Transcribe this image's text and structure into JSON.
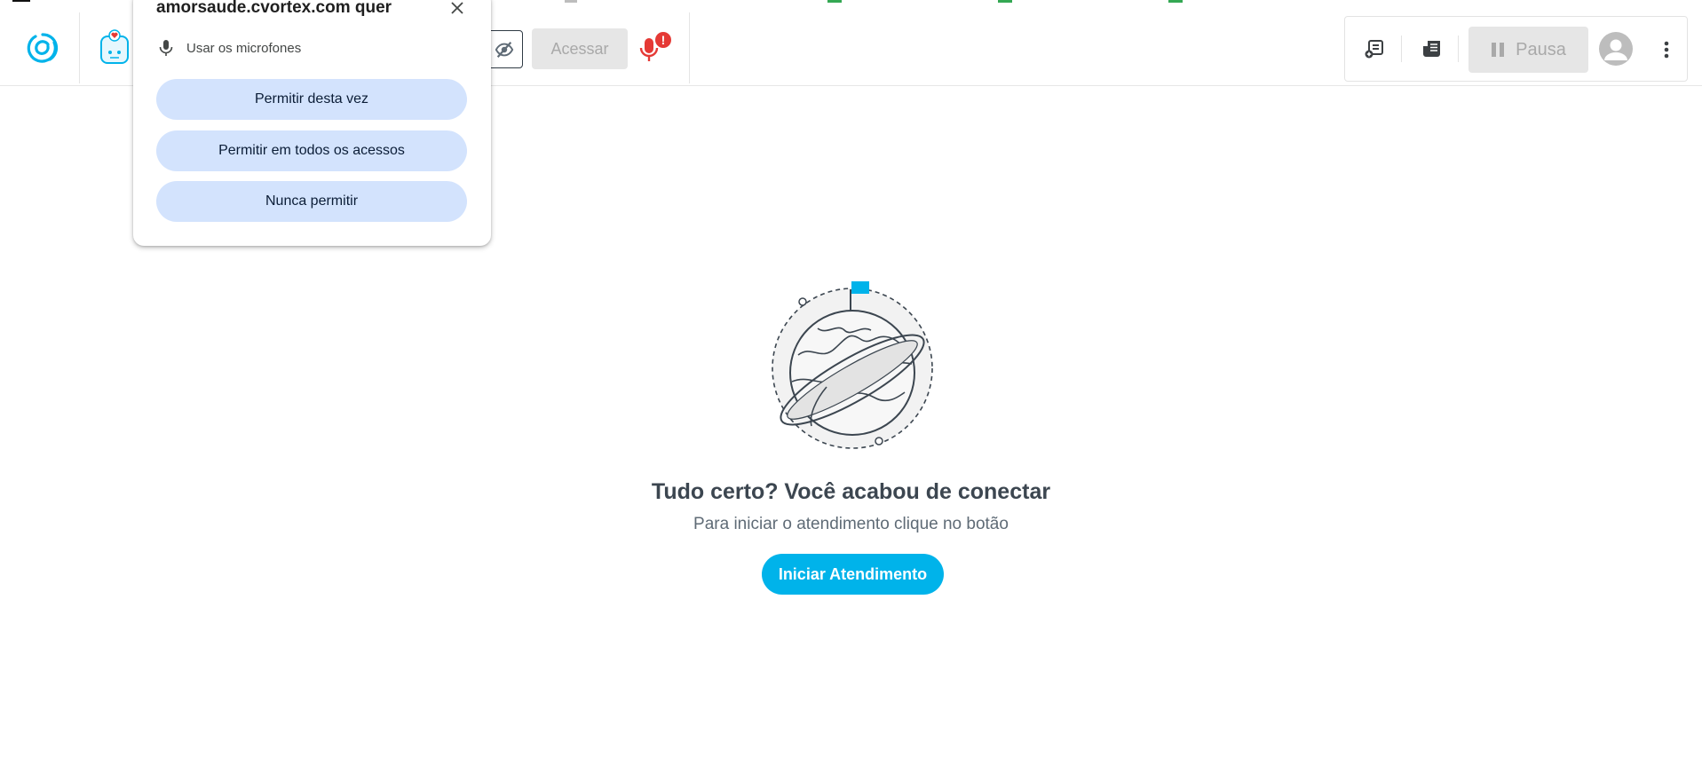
{
  "colors": {
    "brand": "#00b3ea",
    "alert_red": "#e53935",
    "permission_button_bg": "#d3e3fd",
    "disabled_bg": "#e6e6e6",
    "disabled_text": "#a9a9a9"
  },
  "header": {
    "logo_icon": "swirl-logo-icon",
    "robot_icon": "robot-heart-icon",
    "visibility_icon": "eye-off-icon",
    "acessar_label": "Acessar",
    "mic_icon": "microphone-alert-icon",
    "mic_badge": "!"
  },
  "toolbar": {
    "icon1": "document-add-icon",
    "icon2": "newspaper-icon",
    "pausa_label": "Pausa",
    "pause_icon": "pause-icon",
    "avatar_icon": "user-avatar-icon",
    "more_icon": "more-vertical-icon"
  },
  "permission_popup": {
    "title": "amorsaude.cvortex.com quer",
    "request": "Usar os microfones",
    "buttons": [
      "Permitir desta vez",
      "Permitir em todos os acessos",
      "Nunca permitir"
    ]
  },
  "main": {
    "illustration_icon": "planet-flag-icon",
    "headline": "Tudo certo? Você acabou de conectar",
    "subline": "Para iniciar o atendimento clique no botão",
    "start_button": "Iniciar Atendimento"
  }
}
